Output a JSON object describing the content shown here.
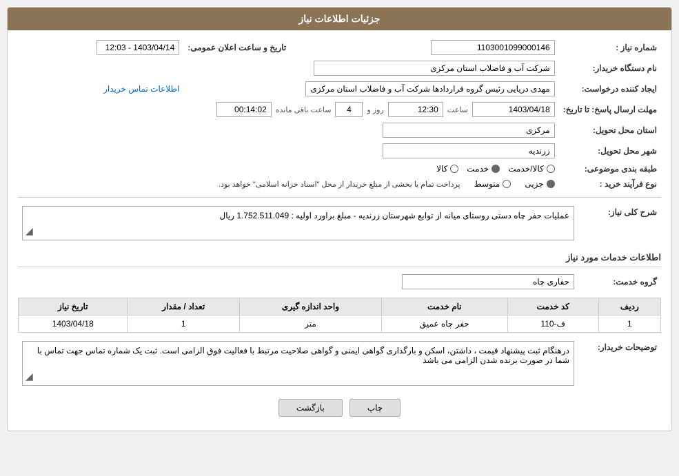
{
  "header": {
    "title": "جزئیات اطلاعات نیاز"
  },
  "fields": {
    "need_number_label": "شماره نیاز :",
    "need_number_value": "1103001099000146",
    "buyer_org_label": "نام دستگاه خریدار:",
    "buyer_org_value": "شرکت آب و فاضلاب استان مرکزی",
    "creator_label": "ایجاد کننده درخواست:",
    "creator_value": "مهدی دریایی رئیس گروه قراردادها شرکت آب و فاضلاب استان مرکزی",
    "contact_info_link": "اطلاعات تماس خریدار",
    "deadline_label": "مهلت ارسال پاسخ: تا تاریخ:",
    "deadline_date": "1403/04/18",
    "deadline_time_label": "ساعت",
    "deadline_time": "12:30",
    "deadline_days_label": "روز و",
    "deadline_days": "4",
    "deadline_remaining_label": "ساعت باقی مانده",
    "deadline_remaining": "00:14:02",
    "announce_label": "تاریخ و ساعت اعلان عمومی:",
    "announce_value": "1403/04/14 - 12:03",
    "province_label": "استان محل تحویل:",
    "province_value": "مرکزی",
    "city_label": "شهر محل تحویل:",
    "city_value": "زرندیه",
    "category_label": "طبقه بندی موضوعی:",
    "category_goods": "کالا",
    "category_service": "خدمت",
    "category_goods_service": "کالا/خدمت",
    "category_selected": "خدمت",
    "purchase_type_label": "نوع فرآیند خرید :",
    "purchase_type_partial": "جزیی",
    "purchase_type_medium": "متوسط",
    "purchase_type_desc": "پرداخت تمام یا بخشی از مبلغ خریدار از محل \"اسناد خزانه اسلامی\" خواهد بود.",
    "description_label": "شرح کلی نیاز:",
    "description_value": "عملیات حفر چاه دستی روستای میانه از توابع شهرستان زرندیه - مبلغ براورد اولیه : 1.752.511.049 ریال",
    "services_section_title": "اطلاعات خدمات مورد نیاز",
    "service_group_label": "گروه خدمت:",
    "service_group_value": "حفاری چاه",
    "table": {
      "headers": [
        "ردیف",
        "کد خدمت",
        "نام خدمت",
        "واحد اندازه گیری",
        "تعداد / مقدار",
        "تاریخ نیاز"
      ],
      "rows": [
        {
          "row": "1",
          "code": "ف-110",
          "name": "حفر چاه عمیق",
          "unit": "متر",
          "quantity": "1",
          "date": "1403/04/18"
        }
      ]
    },
    "buyer_notes_label": "توضیحات خریدار:",
    "buyer_notes_value": "درهنگام ثبت پیشنهاد قیمت ، داشتن، اسکن و بارگذاری گواهی ایمنی و گواهی صلاحیت مرتبط با فعالیت فوق الزامی است.\nثبت یک شماره تماس جهت تماس با شما در صورت برنده شدن الزامی می باشد"
  },
  "buttons": {
    "print": "چاپ",
    "back": "بازگشت"
  },
  "colors": {
    "header_bg": "#8b7355",
    "accent_blue": "#0066cc"
  }
}
